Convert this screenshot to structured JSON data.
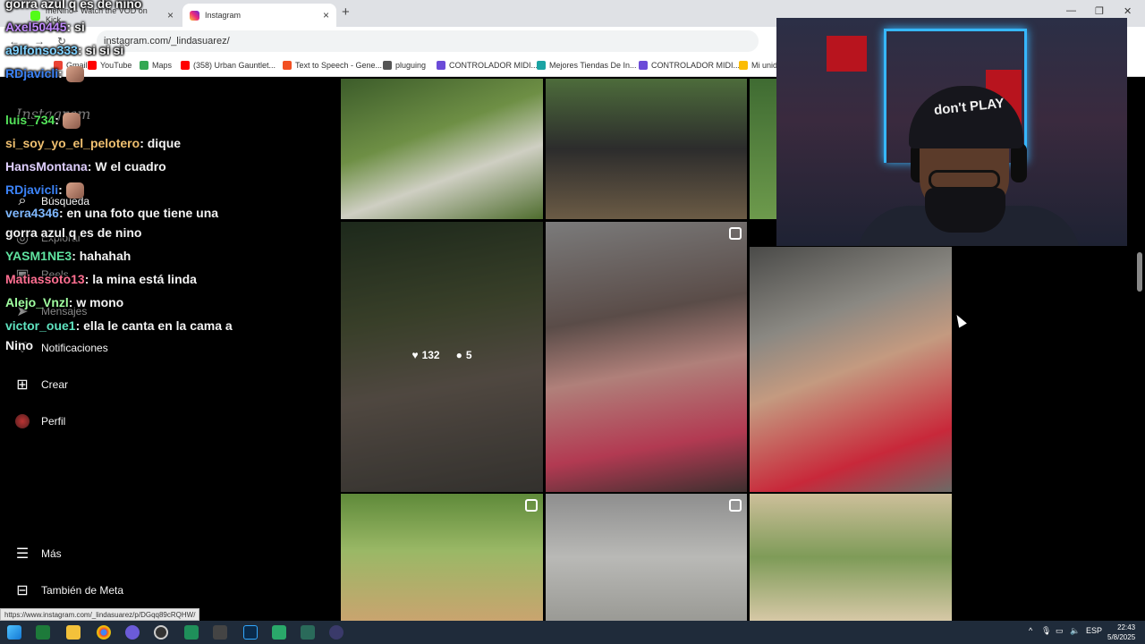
{
  "browser": {
    "tabs": [
      {
        "label": "meNino - Watch the VOD on Kick"
      },
      {
        "label": "Instagram"
      }
    ],
    "url": "instagram.com/_lindasuarez/",
    "status_url": "https://www.instagram.com/_lindasuarez/p/DGqq89cRQHW/",
    "bookmarks": [
      "Gmail",
      "YouTube",
      "Maps",
      "(358) Urban Gauntlet...",
      "Text to Speech - Gene...",
      "pluguing",
      "CONTROLADOR MIDI...",
      "Mejores Tiendas De In...",
      "CONTROLADOR MIDI...",
      "Mi unid"
    ]
  },
  "instagram": {
    "logo": "Instagram",
    "nav": [
      {
        "label": "Búsqueda",
        "icon": "search-icon"
      },
      {
        "label": "Explorar",
        "icon": "compass-icon"
      },
      {
        "label": "Reels",
        "icon": "reels-icon"
      },
      {
        "label": "Mensajes",
        "icon": "messages-icon"
      },
      {
        "label": "Notificaciones",
        "icon": "heart-icon"
      },
      {
        "label": "Crear",
        "icon": "plus-square-icon"
      },
      {
        "label": "Perfil",
        "icon": "avatar"
      },
      {
        "label": "Más",
        "icon": "menu-icon"
      },
      {
        "label": "También de Meta",
        "icon": "meta-grid-icon"
      }
    ],
    "hovered_post": {
      "likes": "132",
      "comments": "5"
    }
  },
  "chat": [
    {
      "user": "",
      "text": "gorra azul q es de nino",
      "color": "#ffffff"
    },
    {
      "user": "Axel50445",
      "text": ": si",
      "color": "#c28bff"
    },
    {
      "user": "a9lfonso333",
      "text": ": si si si",
      "color": "#7fd1ff"
    },
    {
      "user": "RDjavicli",
      "text": ":",
      "color": "#3b82f6",
      "emote": true
    },
    {
      "user": "luis_734",
      "text": ":",
      "color": "#54e35a",
      "emote": true
    },
    {
      "user": "si_soy_yo_el_pelotero",
      "text": ": dique",
      "color": "#f0c070"
    },
    {
      "user": "HansMontana",
      "text": ": W el cuadro",
      "color": "#e0d0ff"
    },
    {
      "user": "RDjavicli",
      "text": ":",
      "color": "#3b82f6",
      "emote": true
    },
    {
      "user": "vera4346",
      "text": ": en una foto que tiene una",
      "color": "#7fb8ff"
    },
    {
      "user": "",
      "text": "gorra azul q es de nino",
      "color": "#ffffff"
    },
    {
      "user": "YASM1NE3",
      "text": ": hahahah",
      "color": "#5fe3a0"
    },
    {
      "user": "Matiassoto13",
      "text": ": la mina está linda",
      "color": "#ff6f91"
    },
    {
      "user": "Alejo_Vnzl",
      "text": ": w mono",
      "color": "#a0ffa0"
    },
    {
      "user": "victor_oue1",
      "text": ": ella le canta en la cama a",
      "color": "#5fe3c0"
    },
    {
      "user": "",
      "text": "Nino",
      "color": "#ffffff"
    }
  ],
  "webcam": {
    "cap_text": "don't PLAY"
  },
  "taskbar": {
    "language": "ESP",
    "time": "22:43",
    "date": "5/8/2025"
  }
}
